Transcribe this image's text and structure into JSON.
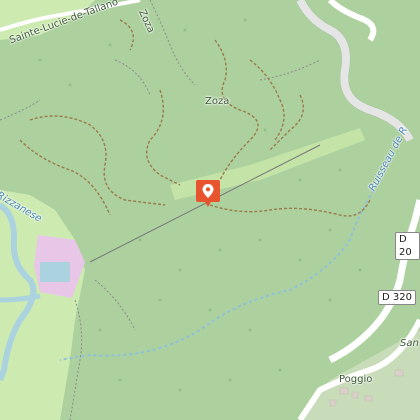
{
  "map": {
    "labels": {
      "village_sainte_lucie": "Sainte-Lucie-de-Tallano",
      "locality_zoza_top": "Zoza",
      "locality_zoza_mid": "Zoza",
      "village_poggio": "Poggio",
      "stream_ruisseau": "Ruisseau de R",
      "river_left": "Rizzanese",
      "label_san": "San"
    },
    "roads": {
      "d20": "D 20",
      "d320": "D 320"
    },
    "marker": {
      "icon": "location-pin-icon",
      "color": "#e8542d"
    },
    "colors": {
      "forest": "#add19e",
      "grass": "#cdebb0",
      "water": "#aad3df",
      "residential": "#e0dfdf",
      "pink": "#e8c6e8",
      "road": "#ffffff",
      "track": "#9a7a4a"
    }
  }
}
